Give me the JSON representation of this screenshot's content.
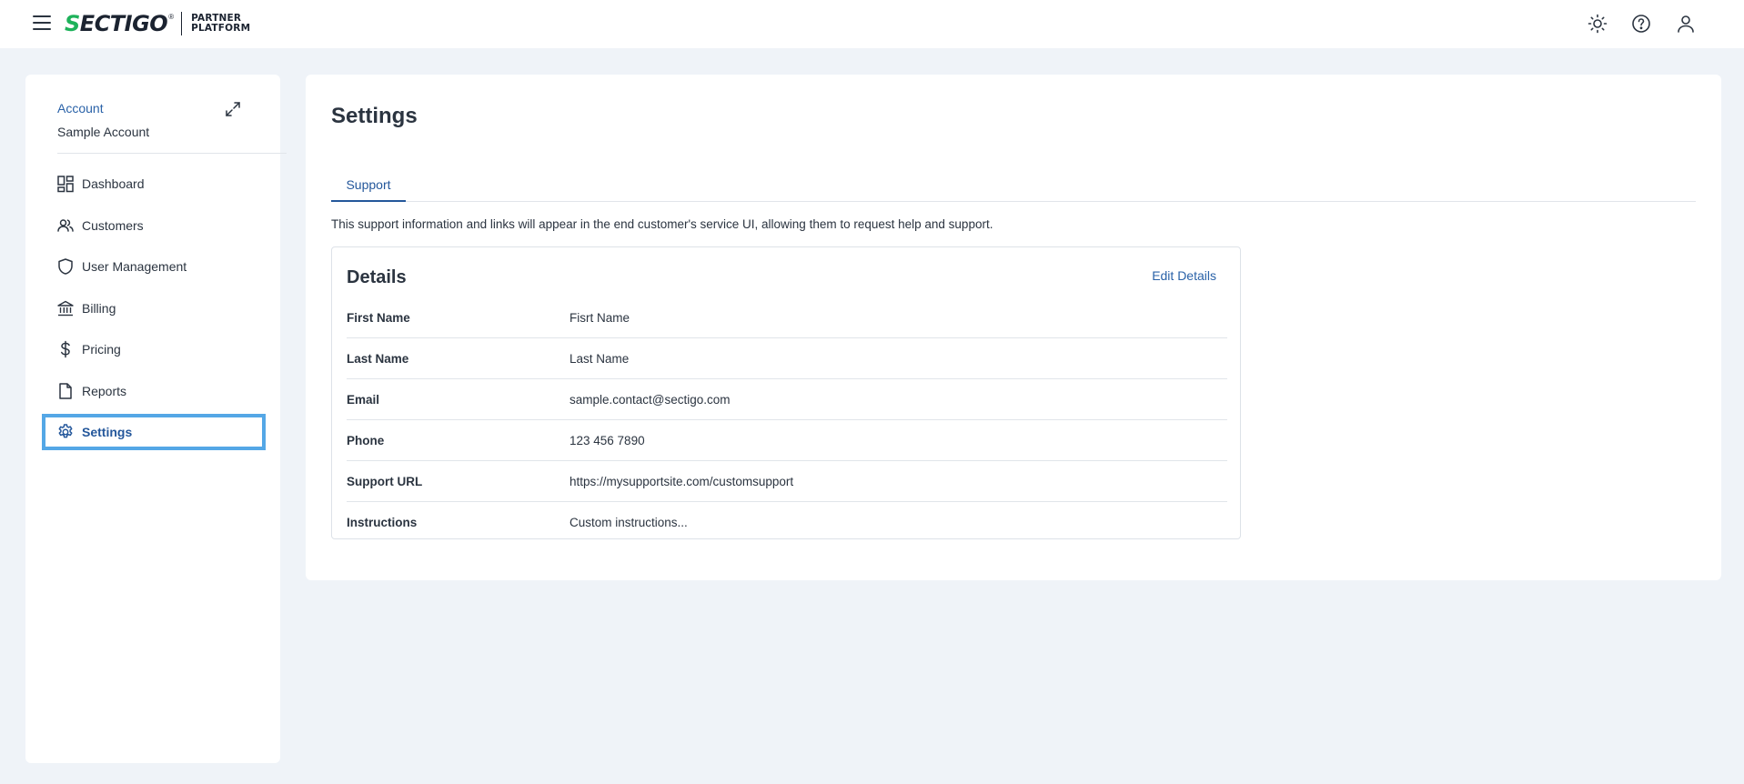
{
  "brand": {
    "logo_word_first": "S",
    "logo_word_rest": "ECTIGO",
    "logo_reg": "®",
    "logo_sub_line1": "PARTNER",
    "logo_sub_line2": "PLATFORM",
    "accent_color": "#1eb25a"
  },
  "header": {
    "icons": [
      "menu-icon",
      "theme-sun-icon",
      "help-icon",
      "user-icon"
    ]
  },
  "sidebar": {
    "account_label": "Account",
    "account_name": "Sample Account",
    "items": [
      {
        "label": "Dashboard",
        "icon": "dashboard-icon"
      },
      {
        "label": "Customers",
        "icon": "customers-icon"
      },
      {
        "label": "User Management",
        "icon": "shield-icon"
      },
      {
        "label": "Billing",
        "icon": "bank-icon"
      },
      {
        "label": "Pricing",
        "icon": "dollar-icon"
      },
      {
        "label": "Reports",
        "icon": "file-icon"
      },
      {
        "label": "Settings",
        "icon": "gear-icon",
        "active": true
      }
    ]
  },
  "main": {
    "title": "Settings",
    "tabs": [
      {
        "label": "Support",
        "active": true
      }
    ],
    "description": "This support information and links will appear in the end customer's service UI, allowing them to request help and support.",
    "details": {
      "title": "Details",
      "edit_label": "Edit Details",
      "rows": [
        {
          "label": "First Name",
          "value": "Fisrt Name"
        },
        {
          "label": "Last Name",
          "value": "Last Name"
        },
        {
          "label": "Email",
          "value": "sample.contact@sectigo.com"
        },
        {
          "label": "Phone",
          "value": "123 456 7890"
        },
        {
          "label": "Support URL",
          "value": "https://mysupportsite.com/customsupport"
        },
        {
          "label": "Instructions",
          "value": "Custom instructions..."
        }
      ]
    }
  }
}
